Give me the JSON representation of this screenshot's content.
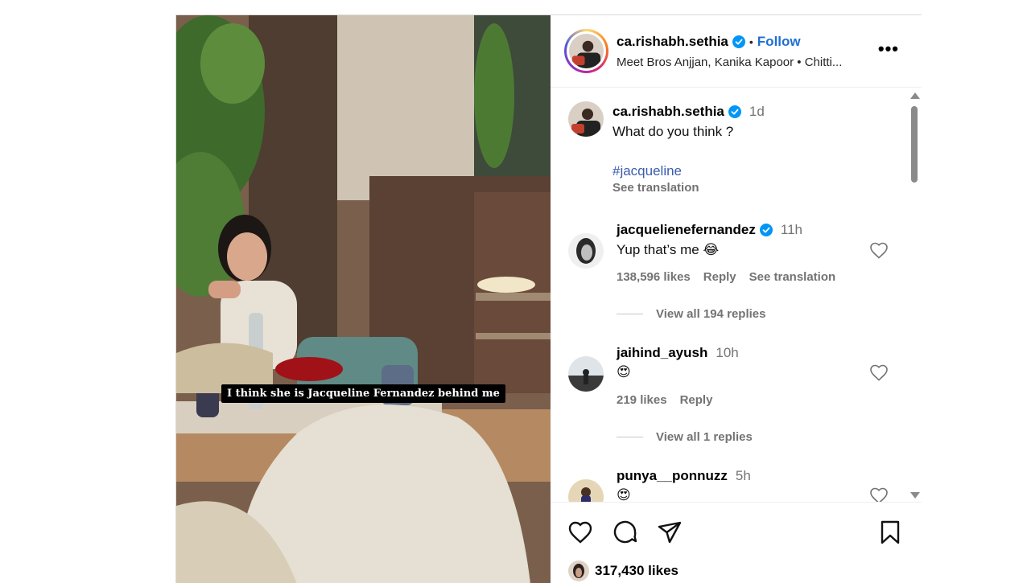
{
  "post": {
    "author": "ca.rishabh.sethia",
    "follow_label": "Follow",
    "dot": "•",
    "subtitle": "Meet Bros Anjjan, Kanika Kapoor • Chitti...",
    "more_label": "•••",
    "overlay_caption": "I think she is Jacqueline Fernandez behind me"
  },
  "caption": {
    "author": "ca.rishabh.sethia",
    "time": "1d",
    "text": "What do you think ?",
    "hashtag": "#jacqueline",
    "see_translation": "See translation"
  },
  "comments": [
    {
      "user": "jacquelienefernandez",
      "verified": true,
      "time": "11h",
      "text": "Yup that’s me 😂",
      "likes": "138,596 likes",
      "reply": "Reply",
      "see_translation": "See translation",
      "view_replies": "View all 194 replies"
    },
    {
      "user": "jaihind_ayush",
      "verified": false,
      "time": "10h",
      "text": "😍",
      "likes": "219 likes",
      "reply": "Reply",
      "view_replies": "View all 1 replies"
    },
    {
      "user": "punya__ponnuzz",
      "verified": false,
      "time": "5h",
      "text": "😍"
    }
  ],
  "footer": {
    "likes": "317,430 likes"
  },
  "icons": {
    "like": "heart-icon",
    "comment": "comment-bubble-icon",
    "share": "paper-plane-icon",
    "save": "bookmark-icon",
    "verified": "verified-badge-icon"
  },
  "colors": {
    "follow": "#1f6fd1",
    "verified": "#0095f6",
    "hashtag": "#3b5cad",
    "muted": "#737373"
  }
}
